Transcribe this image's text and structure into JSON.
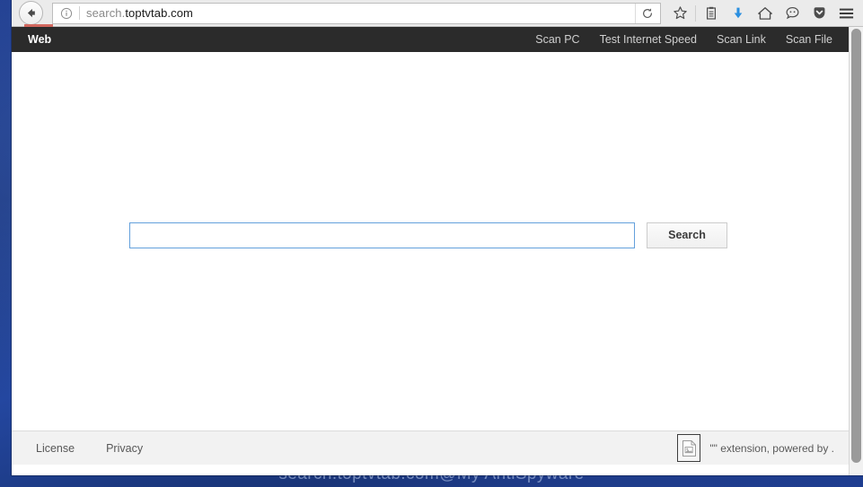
{
  "browser": {
    "back_button": "Back",
    "url_dim": "search.",
    "url_strong": "toptvtab.com",
    "identity_icon": "info-circle-icon",
    "reload_icon": "reload-icon",
    "toolbar_icons": [
      {
        "name": "bookmark-star-icon",
        "label": "Bookmark this page"
      },
      {
        "name": "library-icon",
        "label": "Library"
      },
      {
        "name": "downloads-icon",
        "label": "Downloads"
      },
      {
        "name": "home-icon",
        "label": "Home"
      },
      {
        "name": "sync-chat-icon",
        "label": "Sync"
      },
      {
        "name": "pocket-icon",
        "label": "Save to Pocket"
      },
      {
        "name": "hamburger-menu-icon",
        "label": "Open menu"
      }
    ],
    "accent_download": "#2a8fe0"
  },
  "site": {
    "nav": {
      "tab_label": "Web",
      "tab_underline_color": "#d1675e",
      "background": "#2b2b2b",
      "links": [
        {
          "label": "Scan PC"
        },
        {
          "label": "Test Internet Speed"
        },
        {
          "label": "Scan Link"
        },
        {
          "label": "Scan File"
        }
      ]
    },
    "search": {
      "value": "",
      "placeholder": "",
      "button_label": "Search",
      "border_color": "#63a0dc"
    },
    "footer": {
      "links": [
        {
          "label": "License"
        },
        {
          "label": "Privacy"
        }
      ],
      "extension_icon": "broken-image-icon",
      "extension_text": "\"\" extension, powered by ."
    }
  },
  "desktop": {
    "watermark": "search.toptvtab.com@My AntiSpyware",
    "wallpaper_color": "#1e3a8a"
  },
  "scrollbar": {
    "thumb_color": "#9a9a9a",
    "track_color": "#f1f1f1"
  }
}
